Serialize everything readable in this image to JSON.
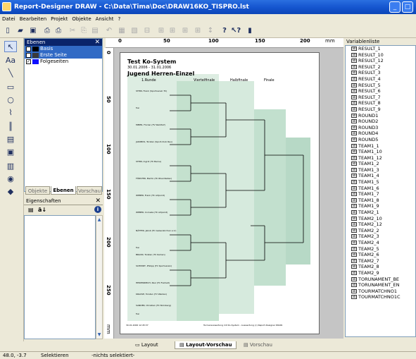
{
  "window": {
    "title": "Report-Designer DRAW - C:\\Data\\Tima\\Doc\\DRAW16KO_TISPRO.lst"
  },
  "menu": [
    "Datei",
    "Bearbeiten",
    "Projekt",
    "Objekte",
    "Ansicht",
    "?"
  ],
  "layers": {
    "title": "Ebenen",
    "items": [
      {
        "label": "Basis",
        "color": "#000000"
      },
      {
        "label": "Erste Seite",
        "color": "#3a3a3a"
      },
      {
        "label": "Folgeseiten",
        "color": "#1010ff"
      }
    ]
  },
  "panel_tabs": [
    "Objekte",
    "Ebenen",
    "Vorschau"
  ],
  "properties": {
    "title": "Eigenschaften"
  },
  "ruler": {
    "unit": "mm",
    "h": [
      "0",
      "50",
      "100",
      "150",
      "200"
    ],
    "v": [
      "0",
      "50",
      "100",
      "150",
      "200",
      "250"
    ]
  },
  "doc": {
    "title": "Test Ko-System",
    "date": "30.01.2006 - 31.01.2006",
    "subtitle": "Jugend Herren-Einzel",
    "rounds": [
      "1.Runde",
      "Viertelfinale",
      "Halbfinale",
      "Finale"
    ],
    "players": [
      "STEIN, Frank (Sportverein TC)",
      "frei",
      "MEIER, Florian (TV Waldhof)",
      "JAKOBUS, Torsten (Sport-Club Reu)",
      "STEIN, Ingrid (TC Berne)",
      "FÖRSTER, Martin (TC Rheinfelden)",
      "WEBER, Frank (TC Artpoint)",
      "WEBER, Cornelia (TC Artpoint)",
      "NÄTTER, Jakob (TC Gelsenkirchen e.V.)",
      "frei",
      "BRAUN, Torsten (TC Kamen)",
      "SCHMIDT, Philipp (TC Sportverein)",
      "HEIDENREICH, Paul (TC Freiheit)",
      "KRAUSE, Torsten (TV Weiden)",
      "SANDER, Christian (TC Nürnberg)",
      "frei"
    ],
    "footer": "30.01.2006 12:45:37",
    "footer_note": "Turnierauswertung mit Ko-System - Auswertung (c) Report-Designer DRAW"
  },
  "view_tabs": [
    "Layout",
    "Layout-Vorschau",
    "Vorschau"
  ],
  "variables": {
    "title": "Variablenliste",
    "items": [
      "RESULT_1",
      "RESULT_10",
      "RESULT_12",
      "RESULT_2",
      "RESULT_3",
      "RESULT_4",
      "RESULT_5",
      "RESULT_6",
      "RESULT_7",
      "RESULT_8",
      "RESULT_9",
      "ROUND1",
      "ROUND2",
      "ROUND3",
      "ROUND4",
      "ROUND5",
      "TEAM1_1",
      "TEAM1_10",
      "TEAM1_12",
      "TEAM1_2",
      "TEAM1_3",
      "TEAM1_4",
      "TEAM1_5",
      "TEAM1_6",
      "TEAM1_7",
      "TEAM1_8",
      "TEAM1_9",
      "TEAM2_1",
      "TEAM2_10",
      "TEAM2_12",
      "TEAM2_2",
      "TEAM2_3",
      "TEAM2_4",
      "TEAM2_5",
      "TEAM2_6",
      "TEAM2_7",
      "TEAM2_8",
      "TEAM2_9",
      "TORUNAMENT_BE",
      "TORUNAMENT_EN",
      "TOURMATCHNO1",
      "TOURMATCHNO1C"
    ]
  },
  "status": {
    "coords": "48.0, -3.7",
    "mode": "Selektieren",
    "selection": "-nichts selektiert-"
  }
}
